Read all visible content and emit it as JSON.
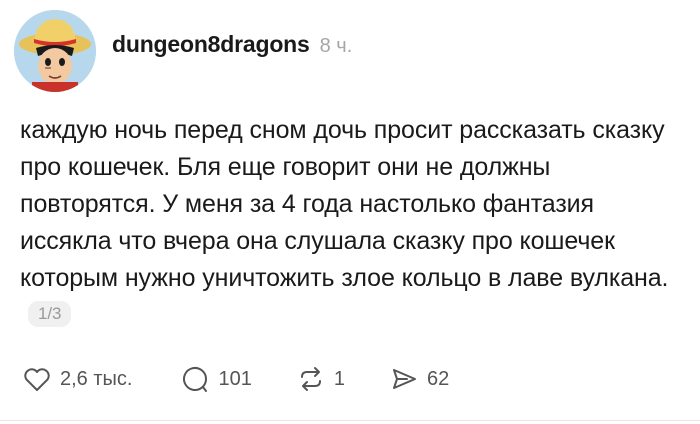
{
  "post": {
    "author": "dungeon8dragons",
    "time": "8 ч.",
    "text": "каждую ночь перед сном дочь просит рассказать сказку про кошечек. Бля еще говорит они не должны повторятся. У меня за 4 года настолько фантазия иссякла что вчера она слушала сказку про кошечек которым нужно уничтожить злое кольцо в лаве вулкана.",
    "page_indicator": "1/3"
  },
  "actions": {
    "likes": "2,6 тыс.",
    "replies": "101",
    "reposts": "1",
    "shares": "62"
  },
  "icons": {
    "like": "heart-icon",
    "reply": "comment-bubble-icon",
    "repost": "repost-arrows-icon",
    "share": "send-paper-plane-icon"
  },
  "colors": {
    "text": "#1a1a1a",
    "muted": "#a6a6a6",
    "icon": "#555555"
  }
}
